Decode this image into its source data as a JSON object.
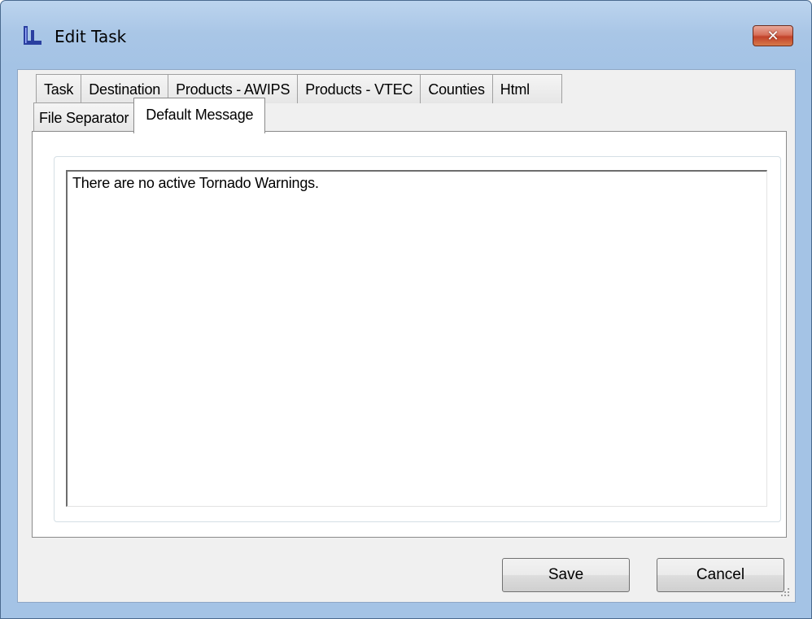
{
  "window": {
    "title": "Edit Task",
    "icon": "app-chart-icon",
    "close_icon": "close-icon"
  },
  "tabs": {
    "row1": [
      "Task",
      "Destination",
      "Products - AWIPS",
      "Products - VTEC",
      "Counties",
      "Html"
    ],
    "row2": [
      "File Separator",
      "Default Message"
    ],
    "active": "Default Message"
  },
  "default_message": {
    "value": "There are no active Tornado Warnings."
  },
  "buttons": {
    "save": "Save",
    "cancel": "Cancel"
  },
  "colors": {
    "titlebar": "#a9c6e6",
    "close_button": "#c2422a",
    "client_bg": "#f0f0f0"
  }
}
